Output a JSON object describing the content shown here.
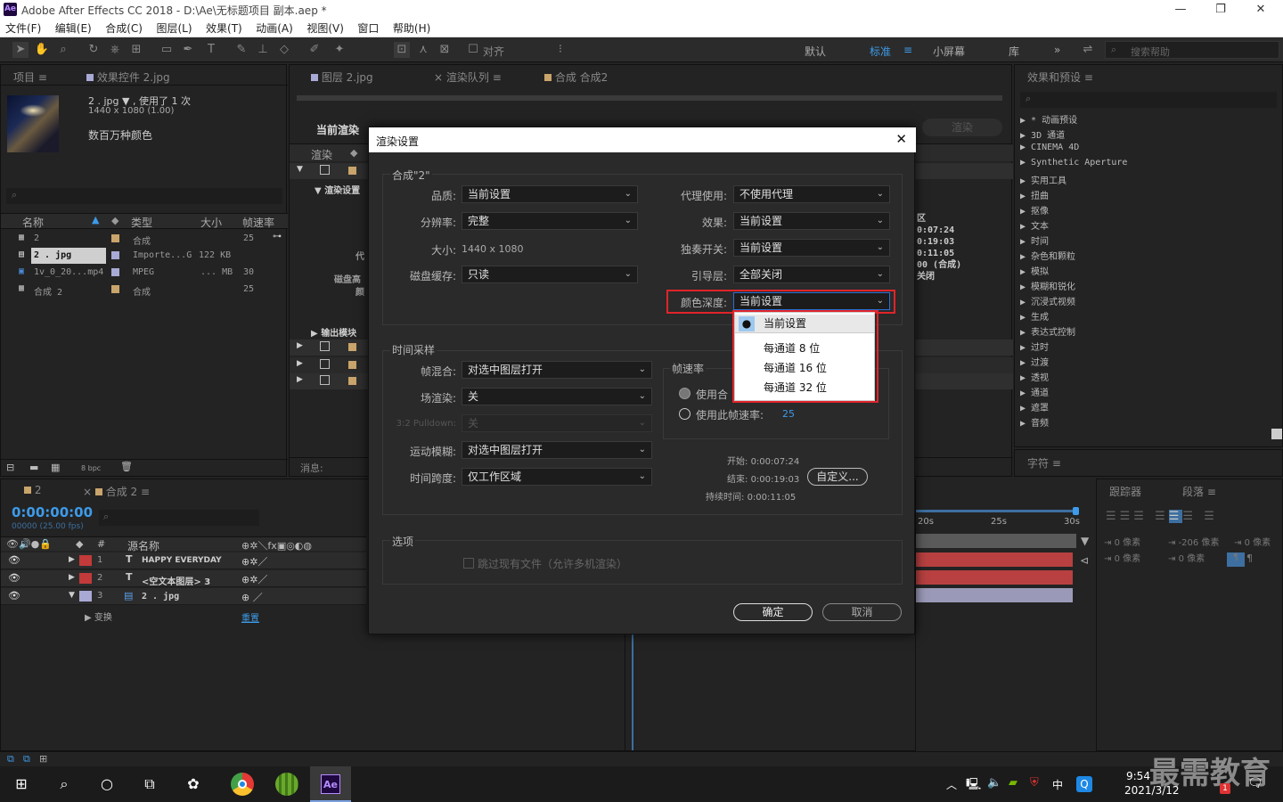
{
  "window": {
    "title": "Adobe After Effects CC 2018 - D:\\Ae\\无标题项目 副本.aep *",
    "logo": "Ae",
    "minimize": "—",
    "restore": "❐",
    "close": "✕"
  },
  "menu": [
    "文件(F)",
    "编辑(E)",
    "合成(C)",
    "图层(L)",
    "效果(T)",
    "动画(A)",
    "视图(V)",
    "窗口",
    "帮助(H)"
  ],
  "toolbar": {
    "snap_label": "对齐",
    "workspaces": [
      "默认",
      "标准",
      "小屏幕",
      "库"
    ],
    "more": "»",
    "search_placeholder": "搜索帮助"
  },
  "project_panel": {
    "tab_project": "项目",
    "tab_effects": "效果控件 2.jpg",
    "item_name": "2 . jpg",
    "used": "▼ , 使用了 1 次",
    "dims": "1440 x 1080 (1.00)",
    "colors": "数百万种颜色",
    "columns": [
      "名称",
      "类型",
      "大小",
      "帧速率"
    ],
    "rows": [
      {
        "name": "2",
        "type": "合成",
        "size": "",
        "fps": "25",
        "color": "#c9a46b"
      },
      {
        "name": "2 . jpg",
        "type": "Importe...G",
        "size": "122 KB",
        "fps": "",
        "color": "#a9a9d6"
      },
      {
        "name": "1v_0_20...mp4",
        "type": "MPEG",
        "size": "... MB",
        "fps": "30",
        "color": "#a9a9d6"
      },
      {
        "name": "合成 2",
        "type": "合成",
        "size": "",
        "fps": "25",
        "color": "#c9a46b"
      }
    ],
    "bpc": "8 bpc"
  },
  "render_panel": {
    "tab_layer": "图层 2.jpg",
    "tab_queue": "渲染队列",
    "tab_comp": "合成 合成2",
    "current_render": "当前渲染",
    "render_label": "渲染",
    "render_settings": "渲染设置",
    "proxy_frag": "代",
    "disk_frag": "磁盘高",
    "color_frag": "颜",
    "output_module": "输出模块",
    "message": "消息:",
    "start_btn": "渲染",
    "info_lines": [
      "区",
      "0:07:24",
      "0:19:03",
      "0:11:05",
      "00 (合成)",
      "关闭"
    ]
  },
  "dialog": {
    "title": "渲染设置",
    "comp_group": "合成\"2\"",
    "quality_label": "品质:",
    "quality": "当前设置",
    "resolution_label": "分辨率:",
    "resolution": "完整",
    "size_label": "大小:",
    "size": "1440 x 1080",
    "disk_cache_label": "磁盘缓存:",
    "disk_cache": "只读",
    "proxy_label": "代理使用:",
    "proxy": "不使用代理",
    "effects_label": "效果:",
    "effects": "当前设置",
    "solo_label": "独奏开关:",
    "solo": "当前设置",
    "guide_label": "引导层:",
    "guide": "全部关闭",
    "color_depth_label": "颜色深度:",
    "color_depth": "当前设置",
    "time_group": "时间采样",
    "frame_blend_label": "帧混合:",
    "frame_blend": "对选中图层打开",
    "field_render_label": "场渲染:",
    "field_render": "关",
    "pulldown_label": "3:2 Pulldown:",
    "pulldown": "关",
    "motion_blur_label": "运动模糊:",
    "motion_blur": "对选中图层打开",
    "time_span_label": "时间跨度:",
    "time_span": "仅工作区域",
    "fps_group": "帧速率",
    "use_comp": "使用合",
    "use_this": "使用此帧速率:",
    "fps_value": "25",
    "start_label": "开始:",
    "start": "0:00:07:24",
    "end_label": "结束:",
    "end": "0:00:19:03",
    "duration_label": "持续时间:",
    "duration": "0:00:11:05",
    "custom_btn": "自定义...",
    "options_group": "选项",
    "skip_existing": "跳过现有文件（允许多机渲染）",
    "ok": "确定",
    "cancel": "取消",
    "close": "✕",
    "dropdown_options": [
      "当前设置",
      "每通道 8 位",
      "每通道 16 位",
      "每通道 32 位"
    ]
  },
  "effects_panel": {
    "tab": "效果和预设",
    "items": [
      "* 动画预设",
      "3D 通道",
      "CINEMA 4D",
      "Synthetic Aperture",
      "实用工具",
      "扭曲",
      "抠像",
      "文本",
      "时间",
      "杂色和颗粒",
      "模拟",
      "模糊和锐化",
      "沉浸式视频",
      "生成",
      "表达式控制",
      "过时",
      "过渡",
      "透视",
      "通道",
      "遮罩",
      "音频"
    ],
    "char_tab": "字符",
    "tracker_tab": "跟踪器",
    "paragraph_tab": "段落",
    "px_labels": [
      "0 像素",
      "-206 像素",
      "0 像素",
      "0 像素",
      "0 像素"
    ]
  },
  "timeline": {
    "tab_2": "2",
    "tab_comp2": "合成 2",
    "timecode": "0:00:00:00",
    "fps_sub": "00000 (25.00 fps)",
    "source_col": "源名称",
    "layers": [
      {
        "num": "1",
        "type": "T",
        "name": "HAPPY EVERYDAY",
        "color": "#c23a3a"
      },
      {
        "num": "2",
        "type": "T",
        "name": "<空文本图层> 3",
        "color": "#c23a3a"
      },
      {
        "num": "3",
        "type": "img",
        "name": "2 . jpg",
        "color": "#a9a9d6"
      }
    ],
    "transform": "变换",
    "reset": "重置",
    "ruler": [
      "20s",
      "25s",
      "30s"
    ]
  },
  "taskbar": {
    "time": "9:54",
    "date": "2021/3/12",
    "ime": "中",
    "badge": "1",
    "watermark": "最需教育"
  }
}
